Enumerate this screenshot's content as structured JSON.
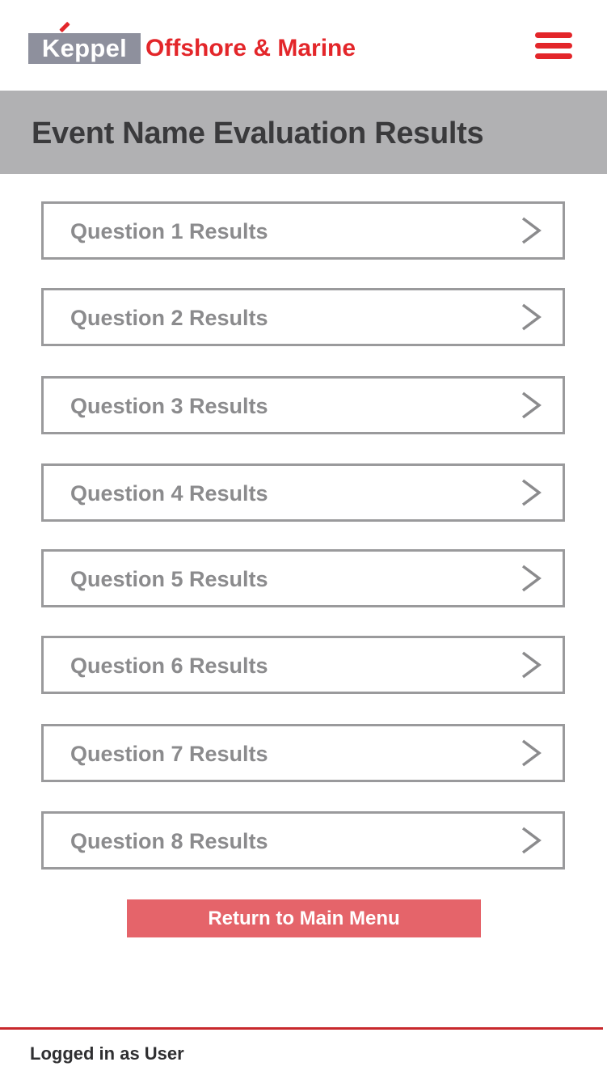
{
  "header": {
    "logo_brand": "Keppel",
    "logo_text": "Offshore & Marine",
    "menu_icon": "hamburger-menu-icon"
  },
  "page": {
    "title": "Event Name Evaluation Results"
  },
  "results": [
    {
      "label": "Question 1 Results",
      "icon": "chevron-right-icon"
    },
    {
      "label": "Question 2 Results",
      "icon": "chevron-right-icon"
    },
    {
      "label": "Question 3 Results",
      "icon": "chevron-right-icon"
    },
    {
      "label": "Question 4 Results",
      "icon": "chevron-right-icon"
    },
    {
      "label": "Question 5 Results",
      "icon": "chevron-right-icon"
    },
    {
      "label": "Question 6 Results",
      "icon": "chevron-right-icon"
    },
    {
      "label": "Question 7 Results",
      "icon": "chevron-right-icon"
    },
    {
      "label": "Question 8 Results",
      "icon": "chevron-right-icon"
    }
  ],
  "actions": {
    "return_label": "Return to Main Menu"
  },
  "footer": {
    "status": "Logged in as User"
  },
  "colors": {
    "brand_red": "#e3262a",
    "logo_grey": "#8e909d",
    "title_band": "#b1b1b3",
    "button_red": "#e5646a",
    "item_border": "#9a9a9c",
    "item_text": "#8b8b8d"
  }
}
